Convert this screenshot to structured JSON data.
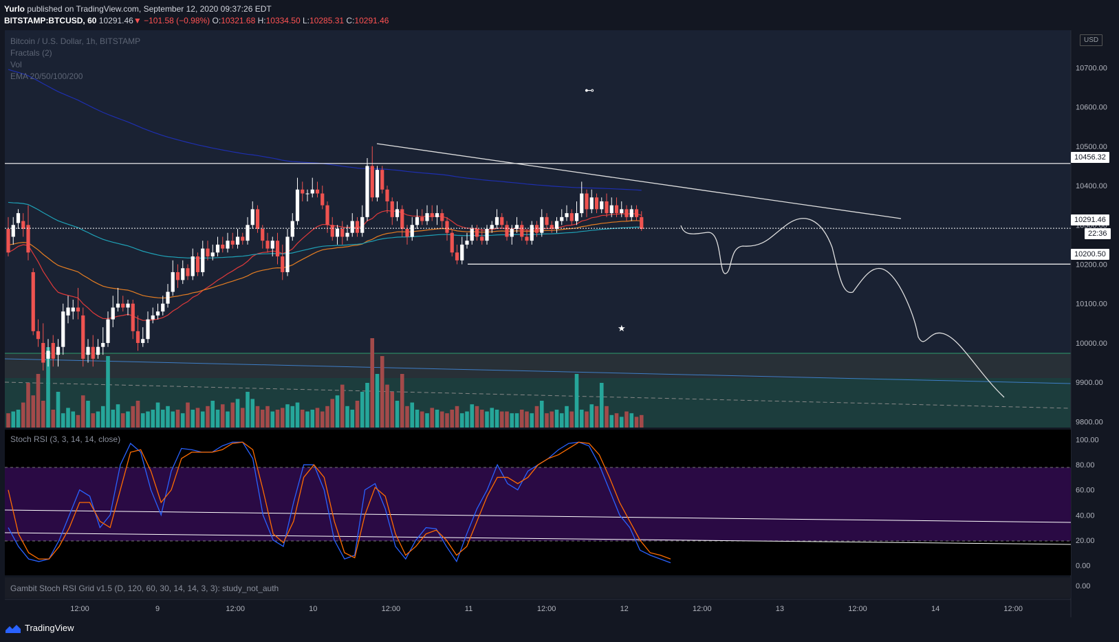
{
  "header": {
    "author": "Yurlo",
    "published_text": "published on TradingView.com, September 12, 2020 09:37:26 EDT",
    "symbol": "BITSTAMP:BTCUSD, 60",
    "last": "10291.46",
    "change": "−101.58 (−0.98%)",
    "o_label": "O:",
    "o": "10321.68",
    "h_label": "H:",
    "h": "10334.50",
    "l_label": "L:",
    "l": "10285.31",
    "c_label": "C:",
    "c": "10291.46"
  },
  "legend": {
    "title": "Bitcoin / U.S. Dollar, 1h, BITSTAMP",
    "fractals": "Fractals (2)",
    "vol": "Vol",
    "ema": "EMA 20/50/100/200",
    "stoch": "Stoch RSI (3, 3, 14, 14, close)",
    "gambit": "Gambit Stoch RSI Grid v1.5 (D, 120, 60, 30, 14, 14, 3, 3): study_not_auth"
  },
  "price_axis": {
    "currency": "USD",
    "ticks": [
      "10700.00",
      "10600.00",
      "10500.00",
      "10400.00",
      "10300.00",
      "10200.00",
      "10100.00",
      "10000.00",
      "9900.00",
      "9800.00"
    ],
    "tags": {
      "resistance": "10456.32",
      "last": "10291.46",
      "countdown": "22:36",
      "support": "10200.50"
    }
  },
  "stoch_axis": {
    "ticks": [
      "100.00",
      "80.00",
      "60.00",
      "40.00",
      "20.00",
      "0.00"
    ]
  },
  "gambit_axis": {
    "ticks": [
      "0.00"
    ]
  },
  "time_axis": {
    "ticks": [
      "12:00",
      "9",
      "12:00",
      "10",
      "12:00",
      "11",
      "12:00",
      "12",
      "12:00",
      "13",
      "12:00",
      "14",
      "12:00"
    ]
  },
  "footer": {
    "brand": "TradingView"
  },
  "colors": {
    "background": "#131722",
    "pane": "#1a2233",
    "up": "#ffffff",
    "down": "#ef5350",
    "vol_up": "#26a69a",
    "vol_down": "#a34a4a",
    "ema20": "#e03a3a",
    "ema50": "#e67e22",
    "ema100": "#1fa3b8",
    "ema200": "#1e2fb0",
    "stoch_k": "#2962ff",
    "stoch_d": "#ff6d00",
    "stoch_band": "#2a0a44"
  },
  "chart_data": [
    {
      "type": "candlestick",
      "title": "Bitcoin / U.S. Dollar, 1h, BITSTAMP",
      "ylim": [
        9785,
        10795
      ],
      "levels": [
        10456.32,
        10291.46,
        10200.5
      ],
      "candles": [
        [
          10290,
          10230,
          10320,
          10220
        ],
        [
          10270,
          10300,
          10320,
          10250
        ],
        [
          10305,
          10330,
          10340,
          10290
        ],
        [
          10310,
          10290,
          10330,
          10270
        ],
        [
          10300,
          10230,
          10350,
          10210
        ],
        [
          10180,
          10030,
          10190,
          10020
        ],
        [
          10030,
          10010,
          10060,
          9990
        ],
        [
          10000,
          9950,
          10050,
          9930
        ],
        [
          9960,
          9980,
          10010,
          9940
        ],
        [
          10000,
          9960,
          10020,
          9940
        ],
        [
          9970,
          9990,
          10010,
          9940
        ],
        [
          9990,
          10080,
          10100,
          9970
        ],
        [
          10070,
          10090,
          10120,
          10050
        ],
        [
          10080,
          10090,
          10110,
          10060
        ],
        [
          10090,
          10080,
          10140,
          10060
        ],
        [
          10070,
          9960,
          10090,
          9940
        ],
        [
          9970,
          9990,
          10010,
          9950
        ],
        [
          9990,
          9960,
          10020,
          9940
        ],
        [
          9970,
          9990,
          10010,
          9960
        ],
        [
          9990,
          10000,
          10040,
          9970
        ],
        [
          10000,
          10060,
          10080,
          9990
        ],
        [
          10060,
          10090,
          10120,
          10040
        ],
        [
          10090,
          10100,
          10140,
          10080
        ],
        [
          10100,
          10090,
          10120,
          10080
        ],
        [
          10090,
          10100,
          10110,
          10070
        ],
        [
          10100,
          10030,
          10110,
          10010
        ],
        [
          10030,
          10000,
          10070,
          9980
        ],
        [
          10000,
          10010,
          10040,
          9990
        ],
        [
          10010,
          10060,
          10080,
          10000
        ],
        [
          10060,
          10070,
          10090,
          10050
        ],
        [
          10070,
          10080,
          10100,
          10060
        ],
        [
          10080,
          10100,
          10120,
          10070
        ],
        [
          10100,
          10130,
          10150,
          10090
        ],
        [
          10130,
          10180,
          10210,
          10120
        ],
        [
          10180,
          10160,
          10200,
          10140
        ],
        [
          10160,
          10190,
          10210,
          10150
        ],
        [
          10190,
          10170,
          10200,
          10160
        ],
        [
          10170,
          10220,
          10240,
          10160
        ],
        [
          10220,
          10180,
          10230,
          10170
        ],
        [
          10180,
          10240,
          10260,
          10170
        ],
        [
          10240,
          10220,
          10260,
          10210
        ],
        [
          10220,
          10230,
          10250,
          10210
        ],
        [
          10230,
          10250,
          10270,
          10220
        ],
        [
          10250,
          10240,
          10270,
          10230
        ],
        [
          10240,
          10260,
          10280,
          10230
        ],
        [
          10260,
          10250,
          10280,
          10240
        ],
        [
          10250,
          10270,
          10290,
          10240
        ],
        [
          10270,
          10260,
          10280,
          10250
        ],
        [
          10260,
          10300,
          10320,
          10250
        ],
        [
          10300,
          10340,
          10360,
          10290
        ],
        [
          10340,
          10290,
          10350,
          10280
        ],
        [
          10290,
          10260,
          10300,
          10240
        ],
        [
          10260,
          10240,
          10280,
          10230
        ],
        [
          10240,
          10260,
          10270,
          10220
        ],
        [
          10260,
          10220,
          10280,
          10200
        ],
        [
          10220,
          10180,
          10250,
          10160
        ],
        [
          10180,
          10270,
          10290,
          10170
        ],
        [
          10270,
          10310,
          10330,
          10260
        ],
        [
          10310,
          10390,
          10420,
          10300
        ],
        [
          10390,
          10380,
          10410,
          10360
        ],
        [
          10380,
          10380,
          10390,
          10360
        ],
        [
          10380,
          10390,
          10420,
          10370
        ],
        [
          10390,
          10380,
          10410,
          10370
        ],
        [
          10380,
          10350,
          10400,
          10340
        ],
        [
          10350,
          10300,
          10360,
          10280
        ],
        [
          10300,
          10270,
          10320,
          10260
        ],
        [
          10270,
          10290,
          10300,
          10250
        ],
        [
          10290,
          10270,
          10310,
          10250
        ],
        [
          10270,
          10280,
          10300,
          10260
        ],
        [
          10280,
          10310,
          10330,
          10270
        ],
        [
          10310,
          10280,
          10320,
          10270
        ],
        [
          10280,
          10320,
          10350,
          10270
        ],
        [
          10320,
          10450,
          10470,
          10310
        ],
        [
          10450,
          10370,
          10500,
          10360
        ],
        [
          10370,
          10440,
          10450,
          10360
        ],
        [
          10440,
          10390,
          10450,
          10380
        ],
        [
          10390,
          10360,
          10400,
          10330
        ],
        [
          10360,
          10320,
          10370,
          10300
        ],
        [
          10320,
          10340,
          10360,
          10310
        ],
        [
          10340,
          10290,
          10350,
          10270
        ],
        [
          10290,
          10270,
          10300,
          10250
        ],
        [
          10270,
          10300,
          10320,
          10260
        ],
        [
          10300,
          10320,
          10340,
          10290
        ],
        [
          10320,
          10310,
          10340,
          10300
        ],
        [
          10310,
          10330,
          10350,
          10300
        ],
        [
          10330,
          10320,
          10350,
          10310
        ],
        [
          10320,
          10330,
          10350,
          10300
        ],
        [
          10330,
          10310,
          10340,
          10290
        ],
        [
          10310,
          10280,
          10320,
          10260
        ],
        [
          10280,
          10230,
          10290,
          10220
        ],
        [
          10230,
          10210,
          10250,
          10200
        ],
        [
          10210,
          10250,
          10270,
          10200
        ],
        [
          10250,
          10260,
          10280,
          10240
        ],
        [
          10260,
          10290,
          10300,
          10250
        ],
        [
          10290,
          10270,
          10300,
          10260
        ],
        [
          10270,
          10260,
          10290,
          10250
        ],
        [
          10260,
          10290,
          10300,
          10250
        ],
        [
          10290,
          10300,
          10310,
          10280
        ],
        [
          10300,
          10320,
          10340,
          10290
        ],
        [
          10320,
          10300,
          10330,
          10290
        ],
        [
          10300,
          10270,
          10310,
          10260
        ],
        [
          10270,
          10290,
          10300,
          10250
        ],
        [
          10290,
          10300,
          10320,
          10280
        ],
        [
          10300,
          10270,
          10310,
          10260
        ],
        [
          10270,
          10260,
          10290,
          10250
        ],
        [
          10260,
          10300,
          10310,
          10250
        ],
        [
          10300,
          10280,
          10310,
          10270
        ],
        [
          10280,
          10320,
          10340,
          10270
        ],
        [
          10320,
          10300,
          10330,
          10290
        ],
        [
          10300,
          10290,
          10310,
          10280
        ],
        [
          10290,
          10310,
          10320,
          10280
        ],
        [
          10310,
          10320,
          10340,
          10300
        ],
        [
          10320,
          10330,
          10350,
          10310
        ],
        [
          10330,
          10310,
          10340,
          10300
        ],
        [
          10310,
          10330,
          10360,
          10300
        ],
        [
          10330,
          10380,
          10410,
          10320
        ],
        [
          10380,
          10340,
          10390,
          10320
        ],
        [
          10340,
          10370,
          10390,
          10330
        ],
        [
          10370,
          10340,
          10380,
          10330
        ],
        [
          10340,
          10360,
          10370,
          10330
        ],
        [
          10360,
          10330,
          10380,
          10320
        ],
        [
          10330,
          10350,
          10370,
          10320
        ],
        [
          10350,
          10330,
          10370,
          10320
        ],
        [
          10330,
          10340,
          10360,
          10320
        ],
        [
          10340,
          10320,
          10350,
          10310
        ],
        [
          10320,
          10340,
          10350,
          10310
        ],
        [
          10340,
          10320,
          10350,
          10310
        ],
        [
          10320,
          10290,
          10335,
          10285
        ]
      ],
      "volume": [
        8,
        9,
        10,
        14,
        25,
        18,
        30,
        15,
        45,
        10,
        20,
        8,
        11,
        9,
        7,
        18,
        15,
        8,
        9,
        12,
        40,
        10,
        13,
        8,
        9,
        12,
        15,
        8,
        9,
        10,
        14,
        10,
        12,
        9,
        10,
        8,
        14,
        10,
        11,
        9,
        12,
        15,
        10,
        13,
        9,
        14,
        16,
        11,
        20,
        16,
        12,
        10,
        12,
        9,
        10,
        11,
        13,
        12,
        14,
        10,
        9,
        10,
        11,
        9,
        12,
        16,
        18,
        24,
        12,
        10,
        15,
        20,
        25,
        50,
        30,
        40,
        24,
        20,
        15,
        30,
        12,
        14,
        10,
        9,
        8,
        11,
        10,
        9,
        8,
        10,
        12,
        8,
        9,
        13,
        12,
        10,
        9,
        11,
        10,
        9,
        9,
        8,
        8,
        10,
        9,
        8,
        12,
        15,
        8,
        9,
        10,
        8,
        12,
        9,
        30,
        10,
        9,
        13,
        12,
        25,
        12,
        7,
        8,
        6,
        9,
        8,
        6,
        7,
        5,
        7,
        6,
        5,
        4,
        5,
        6,
        4,
        10,
        8,
        4
      ]
    },
    {
      "type": "line",
      "title": "Stoch RSI (3, 3, 14, 14, close)",
      "ylim": [
        -8,
        108
      ],
      "series": [
        {
          "values": [
            30,
            15,
            5,
            3,
            5,
            20,
            40,
            60,
            55,
            30,
            40,
            80,
            97,
            90,
            60,
            40,
            75,
            93,
            92,
            90,
            90,
            95,
            98,
            98,
            85,
            40,
            20,
            15,
            50,
            80,
            80,
            60,
            20,
            5,
            8,
            60,
            65,
            45,
            15,
            5,
            20,
            30,
            29,
            15,
            3,
            25,
            45,
            60,
            80,
            65,
            60,
            75,
            80,
            85,
            92,
            97,
            98,
            95,
            80,
            60,
            40,
            30,
            12,
            8,
            5,
            2
          ]
        },
        {
          "values": [
            60,
            25,
            10,
            5,
            5,
            15,
            30,
            50,
            50,
            35,
            30,
            60,
            90,
            92,
            75,
            50,
            60,
            85,
            90,
            90,
            90,
            92,
            97,
            98,
            92,
            60,
            25,
            18,
            35,
            70,
            80,
            70,
            35,
            10,
            6,
            40,
            62,
            55,
            25,
            8,
            15,
            25,
            28,
            20,
            8,
            15,
            35,
            55,
            70,
            70,
            65,
            70,
            80,
            85,
            88,
            93,
            98,
            97,
            88,
            70,
            50,
            35,
            20,
            10,
            8,
            5
          ]
        }
      ]
    }
  ]
}
